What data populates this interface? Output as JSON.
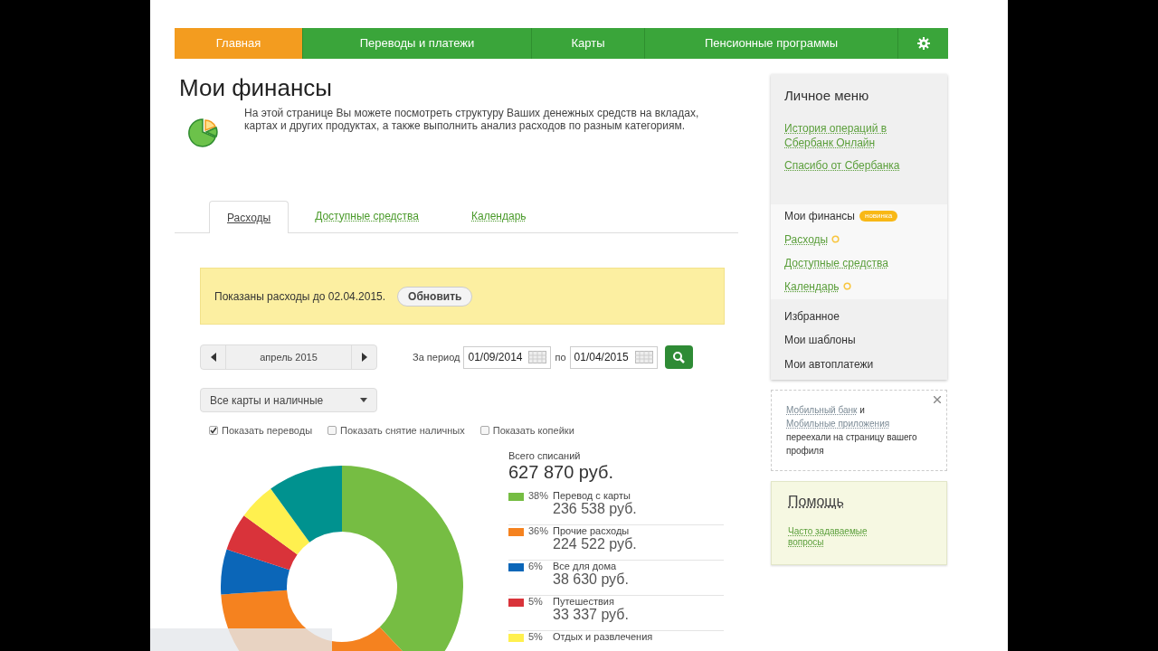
{
  "nav": {
    "items": [
      {
        "label": "Главная",
        "selected": true
      },
      {
        "label": "Переводы и платежи",
        "selected": false
      },
      {
        "label": "Карты",
        "selected": false
      },
      {
        "label": "Пенсионные программы",
        "selected": false
      }
    ]
  },
  "page": {
    "title": "Мои финансы",
    "description": "На этой странице Вы можете посмотреть структуру Ваших денежных средств на вкладах, картах и других продуктах, а также выполнить анализ расходов по разным категориям."
  },
  "tabs": [
    {
      "label": "Расходы",
      "selected": true
    },
    {
      "label": "Доступные средства",
      "selected": false
    },
    {
      "label": "Календарь",
      "selected": false
    }
  ],
  "notice": {
    "text": "Показаны расходы до 02.04.2015.",
    "button": "Обновить"
  },
  "month_switcher": {
    "label": "апрель 2015"
  },
  "period": {
    "label": "За период",
    "from": "01/09/2014",
    "to_label": "по",
    "to": "01/04/2015"
  },
  "account_select": {
    "value": "Все карты и наличные"
  },
  "options": [
    {
      "label": "Показать переводы",
      "checked": true
    },
    {
      "label": "Показать снятие наличных",
      "checked": false
    },
    {
      "label": "Показать копейки",
      "checked": false
    }
  ],
  "summary": {
    "label": "Всего списаний",
    "total": "627 870 руб."
  },
  "categories": [
    {
      "percent": "38%",
      "name": "Перевод с карты",
      "amount": "236 538 руб.",
      "color": "#76bd43"
    },
    {
      "percent": "36%",
      "name": "Прочие расходы",
      "amount": "224 522 руб.",
      "color": "#f5821f"
    },
    {
      "percent": "6%",
      "name": "Все для дома",
      "amount": "38 630 руб.",
      "color": "#0b66b8"
    },
    {
      "percent": "5%",
      "name": "Путешествия",
      "amount": "33 337 руб.",
      "color": "#d9333a"
    },
    {
      "percent": "5%",
      "name": "Отдых и развлечения",
      "color": "#fff04f"
    }
  ],
  "sidebar": {
    "title": "Личное меню",
    "links": [
      "История операций в Сбербанк Онлайн",
      "Спасибо от Сбербанка"
    ],
    "section": {
      "label": "Мои финансы",
      "badge": "новинка",
      "expanded": true,
      "items": [
        {
          "label": "Расходы",
          "new": true
        },
        {
          "label": "Доступные средства",
          "new": false
        },
        {
          "label": "Календарь",
          "new": true
        }
      ]
    },
    "items": [
      "Избранное",
      "Мои шаблоны",
      "Мои автоплатежи"
    ]
  },
  "info_box": {
    "segments": [
      {
        "kind": "link",
        "text": "Мобильный банк"
      },
      {
        "kind": "text",
        "text": " и "
      },
      {
        "kind": "link",
        "text": "Мобильные приложения"
      },
      {
        "kind": "text",
        "text": " переехали на страницу вашего профиля"
      }
    ]
  },
  "help": {
    "title": "Помощь",
    "link": "Часто задаваемые вопросы"
  }
}
